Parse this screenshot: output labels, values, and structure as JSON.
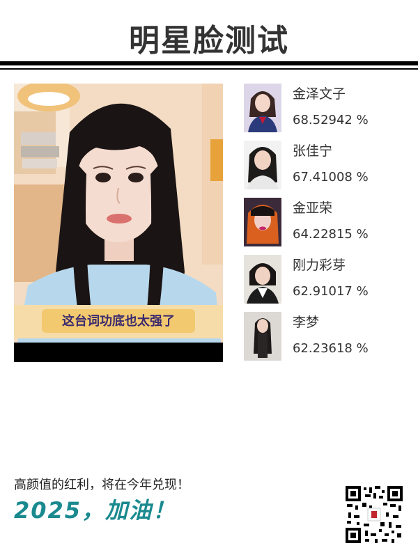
{
  "header": {
    "title": "明星脸测试"
  },
  "photo": {
    "caption": "这台词功底也太强了"
  },
  "results": [
    {
      "name": "金泽文子",
      "score": "68.52942 %"
    },
    {
      "name": "张佳宁",
      "score": "67.41008 %"
    },
    {
      "name": "金亚荣",
      "score": "64.22815 %"
    },
    {
      "name": "刚力彩芽",
      "score": "62.91017 %"
    },
    {
      "name": "李梦",
      "score": "62.23618 %"
    }
  ],
  "footer": {
    "text": "高颜值的红利，将在今年兑现！",
    "slogan": "2025，加油！"
  },
  "colors": {
    "slogan": "#1a8a8f",
    "rule": "#000000"
  },
  "icons": {
    "qr": "qr-code-icon"
  }
}
